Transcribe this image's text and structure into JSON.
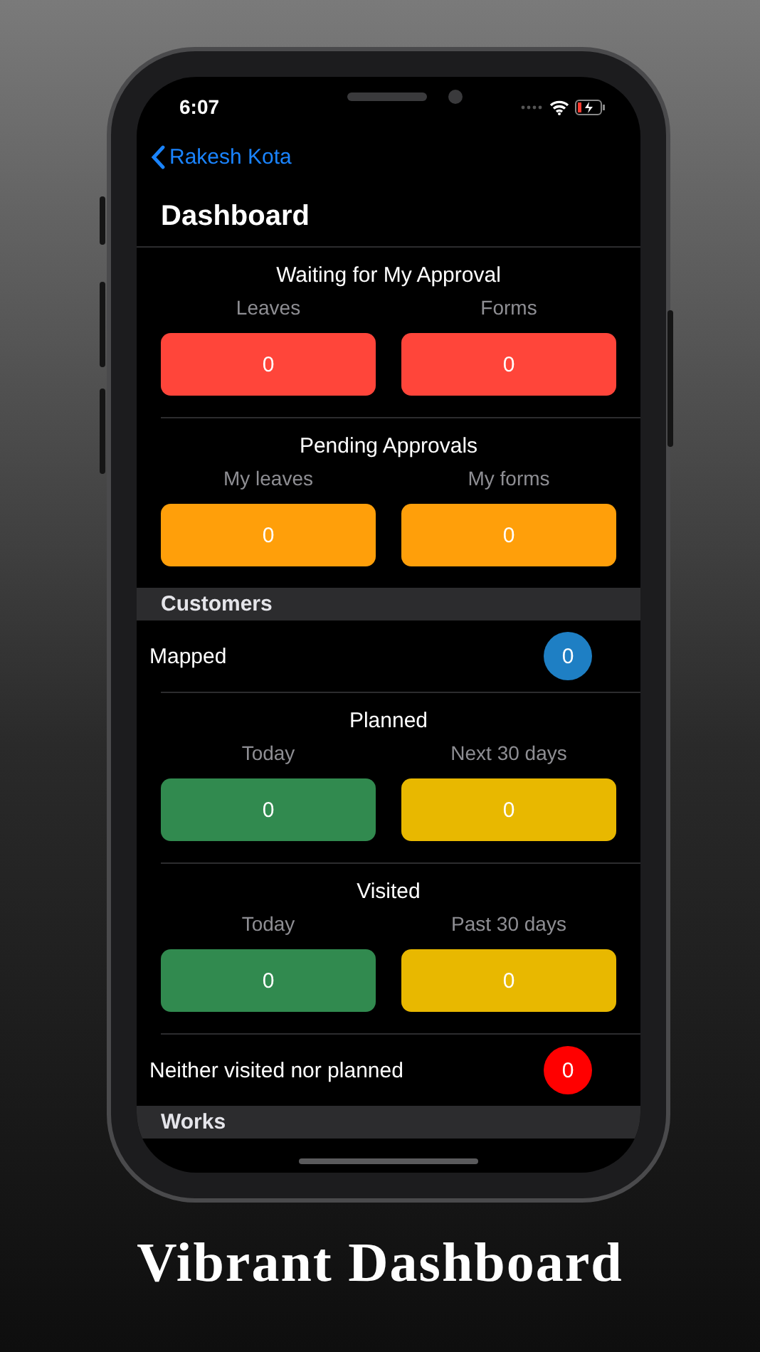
{
  "status_bar": {
    "time": "6:07"
  },
  "nav": {
    "back_label": "Rakesh Kota",
    "title": "Dashboard"
  },
  "rows": [
    {
      "kind": "tiles",
      "title": "Waiting for My Approval",
      "tiles": [
        {
          "label": "Leaves",
          "value": "0",
          "color": "#ff453a"
        },
        {
          "label": "Forms",
          "value": "0",
          "color": "#ff453a"
        }
      ]
    },
    {
      "kind": "tiles",
      "title": "Pending Approvals",
      "tiles": [
        {
          "label": "My leaves",
          "value": "0",
          "color": "#ff9f0a"
        },
        {
          "label": "My forms",
          "value": "0",
          "color": "#ff9f0a"
        }
      ]
    },
    {
      "kind": "header",
      "label": "Customers"
    },
    {
      "kind": "count",
      "label": "Mapped",
      "value": "0",
      "color": "#1e7fc4"
    },
    {
      "kind": "tiles",
      "title": "Planned",
      "tiles": [
        {
          "label": "Today",
          "value": "0",
          "color": "#318a4f"
        },
        {
          "label": "Next 30 days",
          "value": "0",
          "color": "#e8b800"
        }
      ]
    },
    {
      "kind": "tiles",
      "title": "Visited",
      "tiles": [
        {
          "label": "Today",
          "value": "0",
          "color": "#318a4f"
        },
        {
          "label": "Past 30 days",
          "value": "0",
          "color": "#e8b800"
        }
      ]
    },
    {
      "kind": "count",
      "label": "Neither visited nor planned",
      "value": "0",
      "color": "#ff0000"
    },
    {
      "kind": "header",
      "label": "Works"
    }
  ],
  "caption": "Vibrant Dashboard"
}
